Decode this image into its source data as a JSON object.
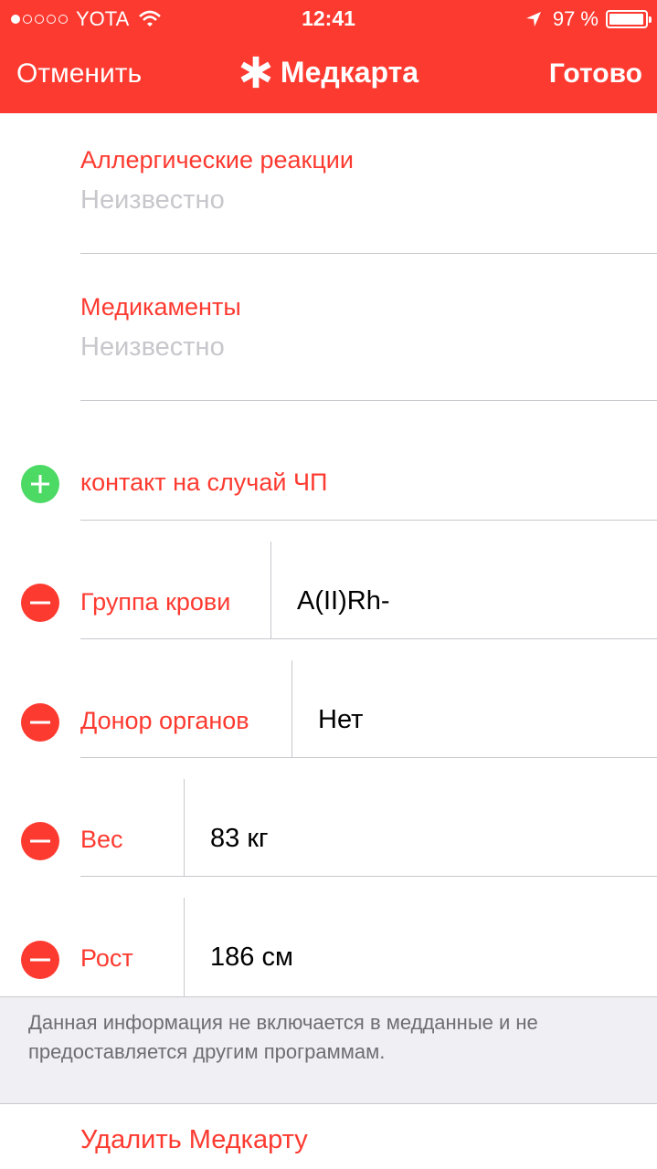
{
  "status_bar": {
    "carrier": "YOTA",
    "time": "12:41",
    "battery": "97 %",
    "battery_level": 0.97,
    "icons": [
      "signal-dots-icon",
      "wifi-icon",
      "location-arrow-icon",
      "battery-icon"
    ]
  },
  "nav": {
    "cancel": "Отменить",
    "title": "Медкарта",
    "done": "Готово",
    "title_icon": "asterisk-icon"
  },
  "fields": [
    {
      "label": "Аллергические реакции",
      "value": "Неизвестно"
    },
    {
      "label": "Медикаменты",
      "value": "Неизвестно"
    }
  ],
  "emergency_contact": {
    "label": "контакт на случай ЧП",
    "icon": "add-circle-icon"
  },
  "rows": [
    {
      "label": "Группа крови",
      "value": "A(II)Rh-",
      "icon": "remove-circle-icon"
    },
    {
      "label": "Донор органов",
      "value": "Нет",
      "icon": "remove-circle-icon"
    },
    {
      "label": "Вес",
      "value": "83 кг",
      "icon": "remove-circle-icon"
    },
    {
      "label": "Рост",
      "value": "186 см",
      "icon": "remove-circle-icon"
    }
  ],
  "footer_note": "Данная информация не включается в медданные и не предоставляется другим программам.",
  "delete_label": "Удалить Медкарту",
  "colors": {
    "accent": "#fd3a30",
    "add": "#4cd964",
    "placeholder": "#c7c7cc",
    "group_bg": "#efeff4"
  }
}
